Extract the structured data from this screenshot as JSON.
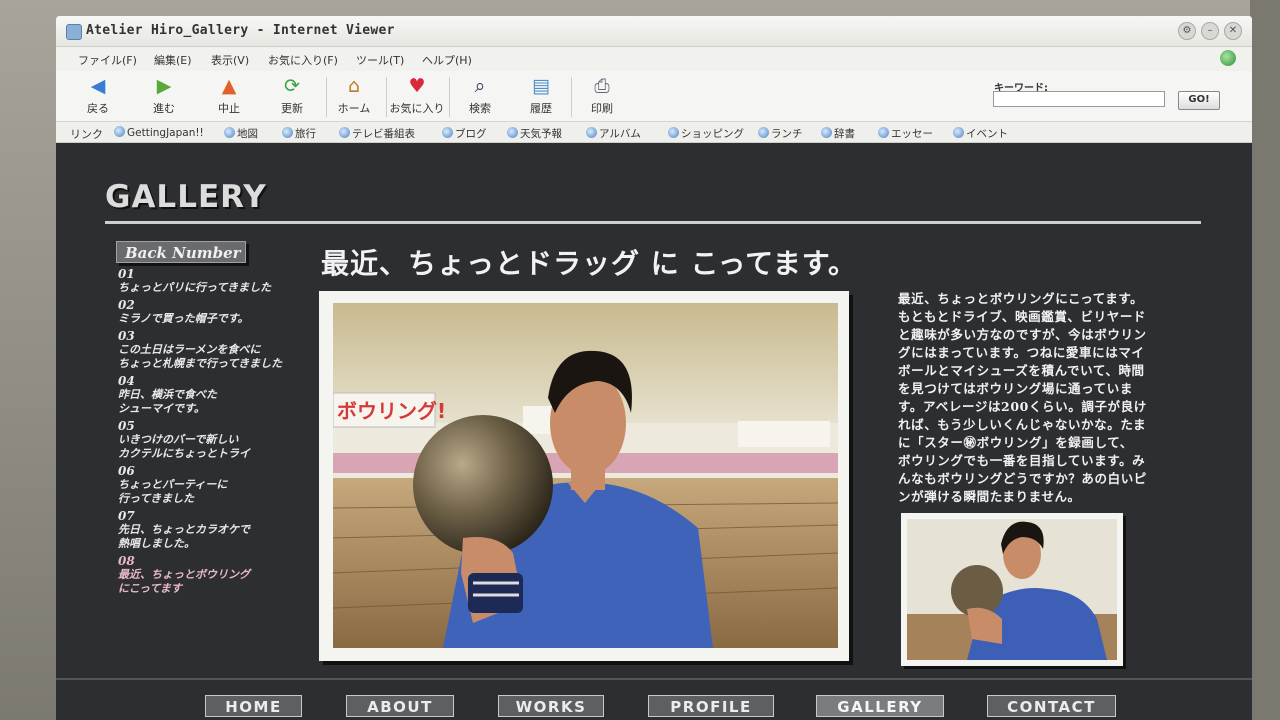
{
  "window": {
    "title": "Atelier Hiro_Gallery - Internet Viewer",
    "controls": [
      "⚙",
      "–",
      "✕"
    ]
  },
  "menu": [
    "ファイル(F)",
    "編集(E)",
    "表示(V)",
    "お気に入り(F)",
    "ツール(T)",
    "ヘルプ(H)"
  ],
  "toolbar": {
    "buttons": [
      {
        "label": "戻る",
        "icon": "back-arrow-icon"
      },
      {
        "label": "進む",
        "icon": "forward-arrow-icon"
      },
      {
        "label": "中止",
        "icon": "stop-cone-icon"
      },
      {
        "label": "更新",
        "icon": "refresh-icon"
      },
      {
        "label": "ホーム",
        "icon": "home-icon"
      },
      {
        "label": "お気に入り",
        "icon": "heart-icon"
      },
      {
        "label": "検索",
        "icon": "magnifier-icon"
      },
      {
        "label": "履歴",
        "icon": "history-book-icon"
      },
      {
        "label": "印刷",
        "icon": "printer-icon"
      }
    ],
    "keyword_label": "キーワード:",
    "keyword_value": "",
    "go_label": "GO!"
  },
  "links": {
    "label": "リンク",
    "items": [
      "GettingJapan!!",
      "地図",
      "旅行",
      "テレビ番組表",
      "ブログ",
      "天気予報",
      "アルバム",
      "ショッピング",
      "ランチ",
      "辞書",
      "エッセー",
      "イベント"
    ]
  },
  "page": {
    "gallery_title": "GALLERY",
    "back_number_label": "Back Number",
    "back_numbers": [
      {
        "num": "01",
        "text": "ちょっとパリに行ってきました"
      },
      {
        "num": "02",
        "text": "ミラノで買った帽子です。"
      },
      {
        "num": "03",
        "text": "この土日はラーメンを食べに\nちょっと札幌まで行ってきました"
      },
      {
        "num": "04",
        "text": "昨日、横浜で食べた\nシューマイです。"
      },
      {
        "num": "05",
        "text": "いきつけのバーで新しい\nカクテルにちょっとトライ"
      },
      {
        "num": "06",
        "text": "ちょっとパーティーに\n行ってきました"
      },
      {
        "num": "07",
        "text": "先日、ちょっとカラオケで\n熱唱しました。"
      },
      {
        "num": "08",
        "text": "最近、ちょっとボウリング\nにこってます"
      }
    ],
    "headline": "最近、ちょっとドラッグ に こってます。",
    "photo_sign": "ボウリング!",
    "body": "最近、ちょっとボウリングにこってます。\nもともとドライブ、映画鑑賞、ビリヤード\nと趣味が多い方なのですが、今はボウリン\nグにはまっています。つねに愛車にはマイ\nボールとマイシューズを積んでいて、時間\nを見つけてはボウリング場に通っていま\nす。アベレージは200くらい。調子が良け\nれば、もう少しいくんじゃないかな。たま\nに「スター㊙ボウリング」を録画して、\nボウリングでも一番を目指しています。み\nんなもボウリングどうですか？あの白いピ\nンが弾ける瞬間たまりません。"
  },
  "nav": [
    "HOME",
    "ABOUT",
    "WORKS",
    "PROFILE",
    "GALLERY",
    "CONTACT"
  ],
  "colors": {
    "page_bg": "#2d2e31",
    "nav_button": "#5d5f63",
    "active_back_number": "#e8b8c8"
  }
}
